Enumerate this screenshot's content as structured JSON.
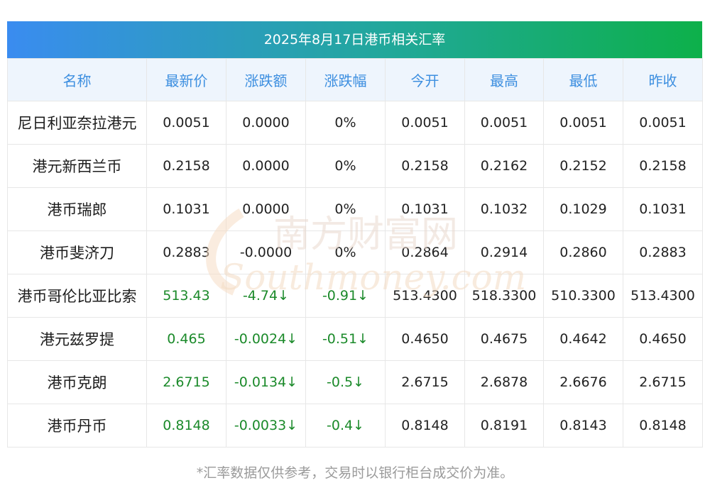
{
  "title": "2025年8月17日港币相关汇率",
  "columns": [
    "名称",
    "最新价",
    "涨跌额",
    "涨跌幅",
    "今开",
    "最高",
    "最低",
    "昨收"
  ],
  "rows": [
    {
      "name": "尼日利亚奈拉港元",
      "latest": "0.0051",
      "change": "0.0000",
      "change_pct": "0%",
      "open": "0.0051",
      "high": "0.0051",
      "low": "0.0051",
      "prev_close": "0.0051",
      "down": false
    },
    {
      "name": "港元新西兰币",
      "latest": "0.2158",
      "change": "0.0000",
      "change_pct": "0%",
      "open": "0.2158",
      "high": "0.2162",
      "low": "0.2152",
      "prev_close": "0.2158",
      "down": false
    },
    {
      "name": "港币瑞郎",
      "latest": "0.1031",
      "change": "0.0000",
      "change_pct": "0%",
      "open": "0.1031",
      "high": "0.1032",
      "low": "0.1029",
      "prev_close": "0.1031",
      "down": false
    },
    {
      "name": "港币斐济刀",
      "latest": "0.2883",
      "change": "-0.0000",
      "change_pct": "0%",
      "open": "0.2864",
      "high": "0.2914",
      "low": "0.2860",
      "prev_close": "0.2883",
      "down": false
    },
    {
      "name": "港币哥伦比亚比索",
      "latest": "513.43",
      "change": "-4.74↓",
      "change_pct": "-0.91↓",
      "open": "513.4300",
      "high": "518.3300",
      "low": "510.3300",
      "prev_close": "513.4300",
      "down": true
    },
    {
      "name": "港元兹罗提",
      "latest": "0.465",
      "change": "-0.0024↓",
      "change_pct": "-0.51↓",
      "open": "0.4650",
      "high": "0.4675",
      "low": "0.4642",
      "prev_close": "0.4650",
      "down": true
    },
    {
      "name": "港币克朗",
      "latest": "2.6715",
      "change": "-0.0134↓",
      "change_pct": "-0.5↓",
      "open": "2.6715",
      "high": "2.6878",
      "low": "2.6676",
      "prev_close": "2.6715",
      "down": true
    },
    {
      "name": "港币丹币",
      "latest": "0.8148",
      "change": "-0.0033↓",
      "change_pct": "-0.4↓",
      "open": "0.8148",
      "high": "0.8191",
      "low": "0.8143",
      "prev_close": "0.8148",
      "down": true
    }
  ],
  "watermark": {
    "cn": "南方财富网",
    "en": "Southmoney.com"
  },
  "footnote": "*汇率数据仅供参考，交易时以银行柜台成交价为准。",
  "colors": {
    "header_text": "#3d8fe0",
    "header_bg": "#eef5fd",
    "down": "#1b8a2a",
    "title_gradient": [
      "#3a8cf0",
      "#0db04a"
    ]
  }
}
